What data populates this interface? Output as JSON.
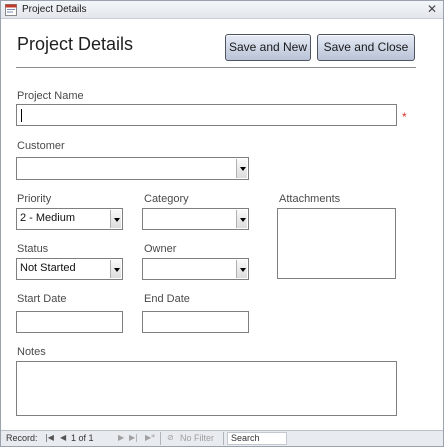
{
  "window": {
    "title": "Project Details"
  },
  "form": {
    "heading": "Project Details",
    "buttons": {
      "save_new": "Save and New",
      "save_close": "Save and Close"
    },
    "labels": {
      "project_name": "Project Name",
      "customer": "Customer",
      "priority": "Priority",
      "category": "Category",
      "attachments": "Attachments",
      "status": "Status",
      "owner": "Owner",
      "start_date": "Start Date",
      "end_date": "End Date",
      "notes": "Notes"
    },
    "values": {
      "project_name": "",
      "customer": "",
      "priority": "2 - Medium",
      "category": "",
      "status": "Not Started",
      "owner": "",
      "start_date": "",
      "end_date": "",
      "notes": ""
    },
    "required_marker": "*"
  },
  "navbar": {
    "record_label": "Record:",
    "position": "1 of 1",
    "filter_label": "No Filter",
    "search_label": "Search"
  },
  "colors": {
    "required": "#d9322a",
    "button_border": "#4f5560"
  }
}
